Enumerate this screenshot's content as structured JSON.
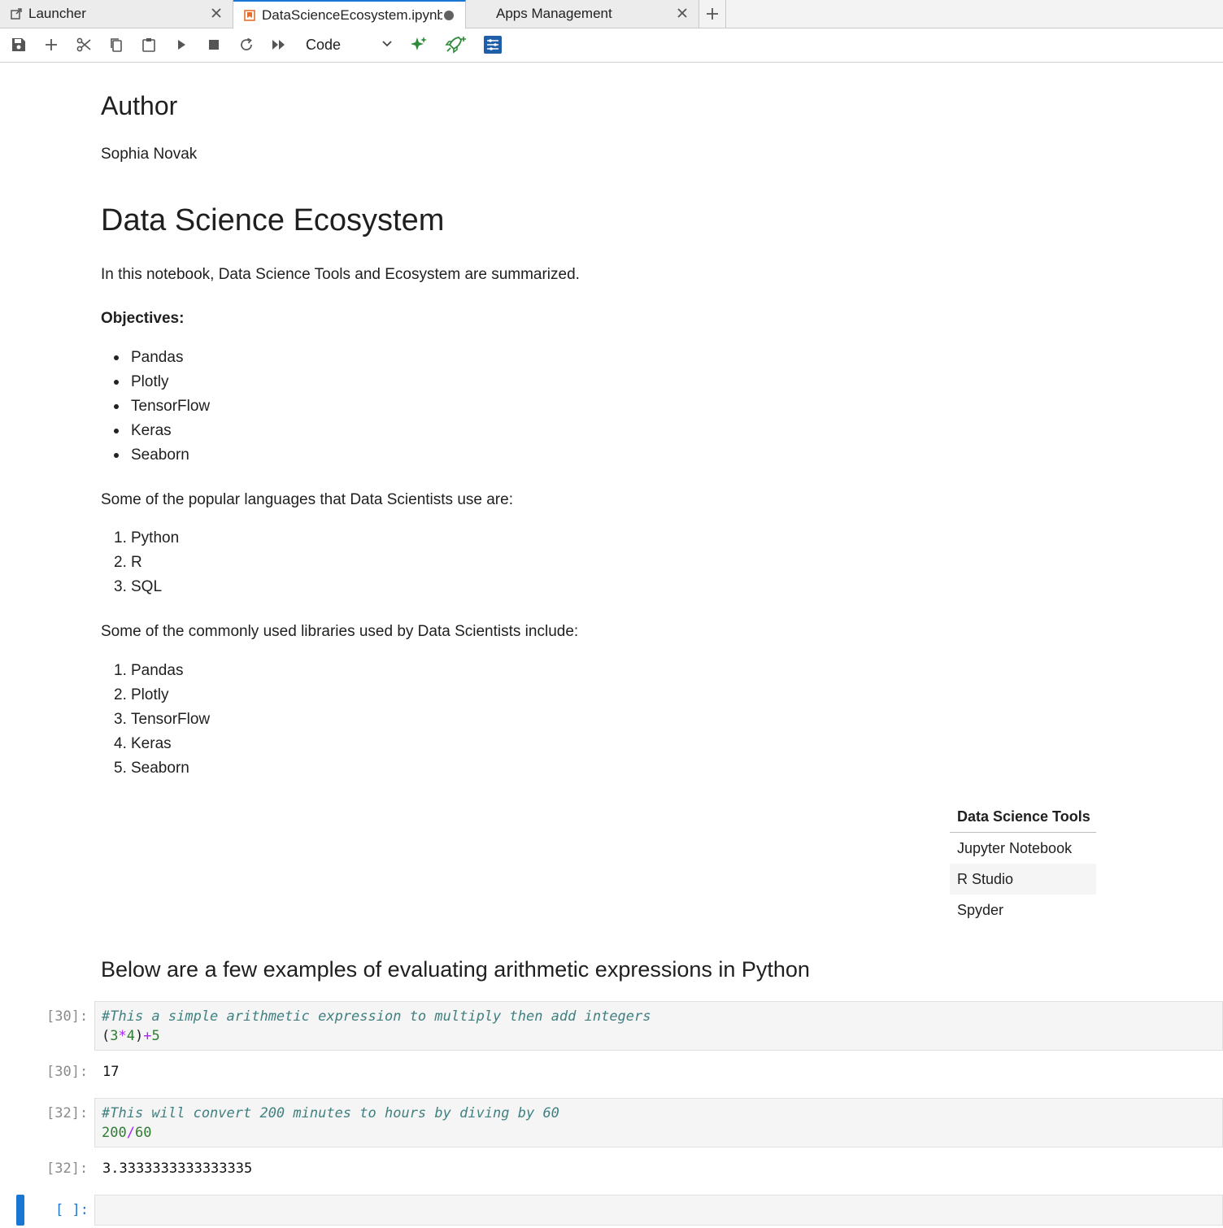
{
  "tabs": [
    {
      "label": "Launcher",
      "icon": "external-link-icon"
    },
    {
      "label": "DataScienceEcosystem.ipynb",
      "icon": "notebook-icon",
      "modified": true
    },
    {
      "label": "Apps Management"
    }
  ],
  "toolbar": {
    "cell_type": "Code"
  },
  "notebook": {
    "author_heading": "Author",
    "author_name": "Sophia Novak",
    "title": "Data Science Ecosystem",
    "intro": "In this notebook, Data Science Tools and Ecosystem are summarized.",
    "objectives_label": "Objectives:",
    "objectives": [
      "Pandas",
      "Plotly",
      "TensorFlow",
      "Keras",
      "Seaborn"
    ],
    "languages_intro": "Some of the popular languages that Data Scientists use are:",
    "languages": [
      "Python",
      "R",
      "SQL"
    ],
    "libraries_intro": "Some of the commonly used libraries used by Data Scientists include:",
    "libraries": [
      "Pandas",
      "Plotly",
      "TensorFlow",
      "Keras",
      "Seaborn"
    ],
    "tools_table": {
      "header": "Data Science Tools",
      "rows": [
        "Jupyter Notebook",
        "R Studio",
        "Spyder"
      ]
    },
    "arith_heading": "Below are a few examples of evaluating arithmetic expressions in Python",
    "cells": [
      {
        "prompt_in": "[30]:",
        "comment": "#This a simple arithmetic expression to multiply then add integers",
        "code": "(3*4)+5",
        "prompt_out": "[30]:",
        "output": "17"
      },
      {
        "prompt_in": "[32]:",
        "comment": "#This will convert 200 minutes to hours by diving by 60",
        "code": "200/60",
        "prompt_out": "[32]:",
        "output": "3.3333333333333335"
      }
    ],
    "empty_prompt": "[ ]:"
  },
  "colors": {
    "accent": "#1976d2",
    "comment": "#408080",
    "number": "#2e7d32",
    "operator": "#aa22ff"
  }
}
